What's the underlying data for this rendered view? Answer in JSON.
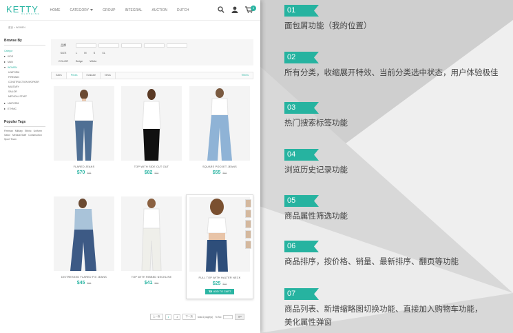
{
  "header": {
    "logo": "KETTY",
    "logo_sub": "CLOTHING",
    "nav": [
      "HOME",
      "CATEGORY",
      "GROUP",
      "INTEGRAL",
      "AUCTION",
      "DUTCH"
    ],
    "cart_count": "0"
  },
  "breadcrumb": "首页  >  WOMEN",
  "sidebar": {
    "browse_title": "Browse By",
    "category_label": "Categor",
    "items": [
      "KIDS",
      "MAN",
      "WOMEN"
    ],
    "women_sub": [
      "UNIFORM",
      "FIREMAN",
      "CONSTRUCTION WORKER",
      "MILITARY",
      "SAILOR",
      "MEDICAL STAFF"
    ],
    "items_after": [
      "UNIFORM",
      "ETHNIC"
    ],
    "tags_title": "Popular Tags",
    "tags": [
      "Fireman",
      "Military",
      "Ethnic",
      "Uniform",
      "Sailor",
      "Medical Staff",
      "Construction",
      "Sport Team"
    ]
  },
  "filters": {
    "brand_label": "品牌",
    "size_label": "SIZE",
    "sizes": [
      "L",
      "M",
      "S",
      "XL"
    ],
    "color_label": "COLOR",
    "colors": [
      "Beige",
      "White"
    ]
  },
  "sortbar": {
    "options": [
      "Sales",
      "Prices",
      "Evaluate",
      "News"
    ],
    "items_label": "7Items"
  },
  "products": [
    {
      "name": "FLARED JEANS",
      "price": "$70",
      "old": "$95"
    },
    {
      "name": "TOP WITH SIDE CUT OUT",
      "price": "$82",
      "old": "$75"
    },
    {
      "name": "SQUARE POCKET JEANS",
      "price": "$55",
      "old": "$65"
    },
    {
      "name": "DISTRESSED FLARED FIX JEANS",
      "price": "$45",
      "old": "$56"
    },
    {
      "name": "TOP WITH RIBBED NECKLINE",
      "price": "$41",
      "old": "$65"
    },
    {
      "name": "FULL TOP WITH HALTER NECK",
      "price": "$25",
      "old": "$35",
      "add_to_cart": "ADD TO CART"
    }
  ],
  "pager": {
    "prev": "上一页",
    "pages": [
      "1",
      "2"
    ],
    "next": "下一页",
    "total": "total 2 page(s)",
    "goto": "To No",
    "go_btn": "ｇo"
  },
  "features": [
    {
      "num": "01",
      "text": "面包屑功能（我的位置）"
    },
    {
      "num": "02",
      "text": "所有分类，收缩展开特效、当前分类选中状态，用户体验极佳"
    },
    {
      "num": "03",
      "text": "热门搜索标签功能"
    },
    {
      "num": "04",
      "text": "浏览历史记录功能"
    },
    {
      "num": "05",
      "text": "商品属性筛选功能"
    },
    {
      "num": "06",
      "text": "商品排序，按价格、销量、最新排序、翻页等功能"
    },
    {
      "num": "07",
      "text": "商品列表、新增缩略图切换功能、直接加入购物车功能，",
      "text2": "美化属性弹窗"
    }
  ],
  "colors": {
    "accent": "#2bb5a3",
    "flag": "#26b3a0"
  }
}
